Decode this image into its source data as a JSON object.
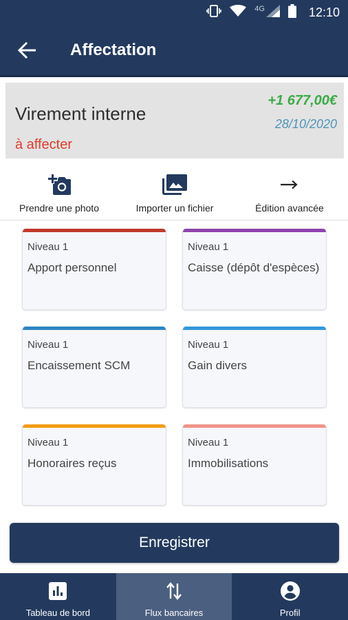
{
  "status_bar": {
    "network": "4G",
    "time": "12:10"
  },
  "header": {
    "title": "Affectation"
  },
  "transaction": {
    "title": "Virement interne",
    "status": "à affecter",
    "amount": "+1 677,00€",
    "date": "28/10/2020",
    "colors": {
      "amount": "#3bab47",
      "date": "#4f95b8",
      "status": "#e23b2b"
    }
  },
  "actions": {
    "take_photo": "Prendre une photo",
    "import_file": "Importer un fichier",
    "advanced_edit": "Édition avancée"
  },
  "categories": [
    {
      "level": "Niveau 1",
      "name": "Apport personnel",
      "color": "#c0392b"
    },
    {
      "level": "Niveau 1",
      "name": "Caisse (dépôt d'espèces)",
      "color": "#8e44ad"
    },
    {
      "level": "Niveau 1",
      "name": "Encaissement SCM",
      "color": "#2e86c1"
    },
    {
      "level": "Niveau 1",
      "name": "Gain divers",
      "color": "#3498db"
    },
    {
      "level": "Niveau 1",
      "name": "Honoraires reçus",
      "color": "#f39c12"
    },
    {
      "level": "Niveau 1",
      "name": "Immobilisations",
      "color": "#f1948a"
    }
  ],
  "save_button": "Enregistrer",
  "bottom_nav": [
    {
      "label": "Tableau de bord",
      "icon": "bar-chart-icon"
    },
    {
      "label": "Flux bancaires",
      "icon": "transfer-arrows-icon",
      "active": true
    },
    {
      "label": "Profil",
      "icon": "account-circle-icon"
    }
  ],
  "theme": {
    "primary": "#233a5e",
    "nav_active": "#4b5f80"
  }
}
